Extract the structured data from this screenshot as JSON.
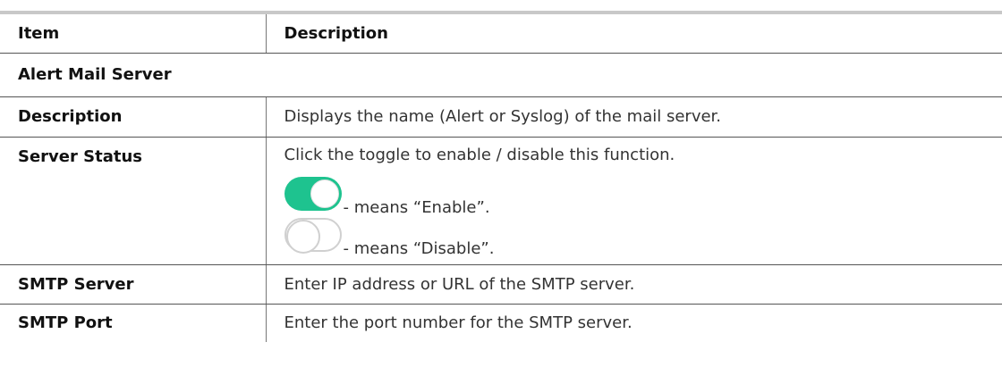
{
  "table": {
    "header": {
      "item": "Item",
      "description": "Description"
    },
    "section_title": "Alert Mail Server",
    "rows": {
      "description": {
        "item": "Description",
        "text": "Displays the name (Alert or Syslog) of the mail server."
      },
      "server_status": {
        "item": "Server Status",
        "text": "Click the toggle to enable / disable this function.",
        "enable_text": "- means “Enable”.",
        "disable_text": "- means “Disable”."
      },
      "smtp_server": {
        "item": "SMTP Server",
        "text": "Enter IP address or URL of the SMTP server."
      },
      "smtp_port": {
        "item": "SMTP Port",
        "text": "Enter the port number for the SMTP server."
      }
    }
  },
  "colors": {
    "toggle_on": "#1ec38f",
    "toggle_off_border": "#d0d0d0",
    "rule": "#555555",
    "top_rule": "#c8c8c8"
  },
  "icons": {
    "toggle_on": "toggle-on-icon",
    "toggle_off": "toggle-off-icon"
  }
}
